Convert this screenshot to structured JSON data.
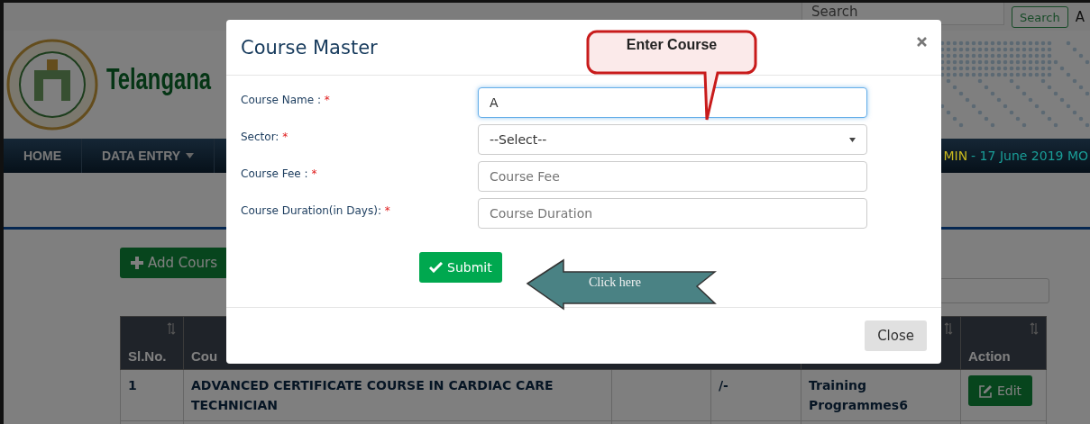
{
  "top_bar": {
    "search": {
      "placeholder": "Search"
    },
    "search_button": "Search",
    "letter": "A"
  },
  "header": {
    "title": "Telangana"
  },
  "nav": {
    "items": [
      {
        "label": "HOME",
        "dropdown": false
      },
      {
        "label": "DATA ENTRY",
        "dropdown": true
      }
    ],
    "marquee": [
      {
        "text": "MIN",
        "color": "#c8b81e"
      },
      {
        "text": "- 17 June 2019 MO",
        "color": "#1a9e98"
      }
    ]
  },
  "add_button": "Add Cours",
  "table": {
    "columns": [
      {
        "label": "Sl.No.",
        "sortable": true
      },
      {
        "label": "Cou"
      },
      {
        "sortable": true
      },
      {
        "label": "Action",
        "sortable": true
      }
    ],
    "rows": [
      {
        "sl": "1",
        "course": "ADVANCED CERTIFICATE COURSE IN CARDIAC CARE TECHNICIAN",
        "fee": "/-",
        "type": "Training Programmes6",
        "action": "Edit"
      }
    ]
  },
  "modal": {
    "title": "Course Master",
    "fields": [
      {
        "kind": "text",
        "label": "Course Name :",
        "mark": "*",
        "value": "A",
        "focused": true
      },
      {
        "kind": "select",
        "label": "Sector:",
        "mark": "*",
        "value": "--Select--",
        "focused": false
      },
      {
        "kind": "text",
        "label": "Course Fee :",
        "mark": "*",
        "placeholder": "Course Fee",
        "focused": false
      },
      {
        "kind": "text",
        "label": "Course Duration(in Days):",
        "mark": "*",
        "placeholder": "Course Duration",
        "focused": false
      }
    ],
    "submit": "Submit",
    "close": "Close"
  },
  "callouts": [
    {
      "kind": "bubble",
      "text": "Enter Course"
    },
    {
      "kind": "arrow",
      "text": "Click here"
    }
  ]
}
